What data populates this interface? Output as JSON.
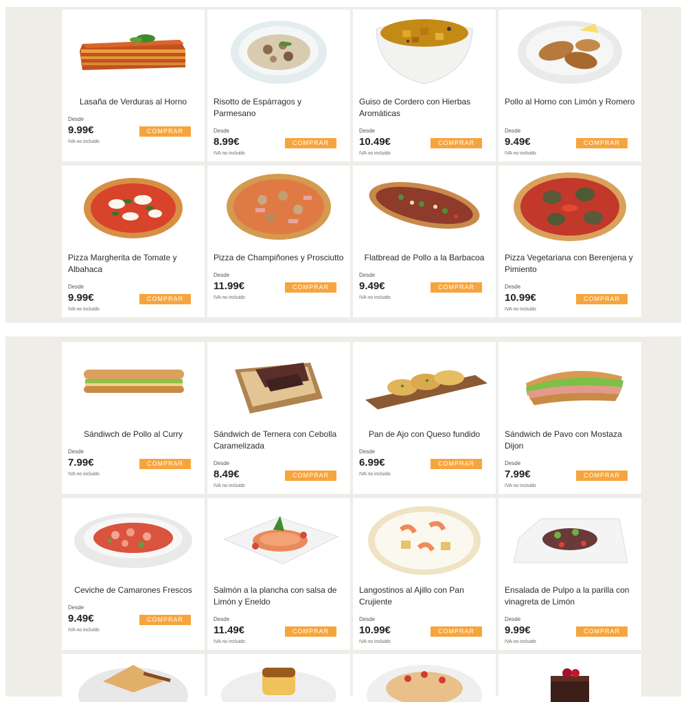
{
  "labels": {
    "desde": "Desde",
    "iva": "IVA no incluido",
    "buy": "COMPRAR"
  },
  "section1": [
    {
      "name": "Lasaña de Verduras al Horno",
      "price": "9.99€"
    },
    {
      "name": "Risotto de Espárragos y Parmesano",
      "price": "8.99€"
    },
    {
      "name": "Guiso de Cordero con Hierbas Aromáticas",
      "price": "10.49€"
    },
    {
      "name": "Pollo al Horno con Limón y Romero",
      "price": "9.49€"
    },
    {
      "name": "Pizza Margherita de Tomate y Albahaca",
      "price": "9.99€"
    },
    {
      "name": "Pizza de Champiñones y Prosciutto",
      "price": "11.99€"
    },
    {
      "name": "Flatbread de Pollo a la Barbacoa",
      "price": "9.49€"
    },
    {
      "name": "Pizza Vegetariana con Berenjena y Pimiento",
      "price": "10.99€"
    }
  ],
  "section2": [
    {
      "name": "Sándiwch de Pollo al Curry",
      "price": "7.99€"
    },
    {
      "name": "Sándwich de Ternera con Cebolla Caramelizada",
      "price": "8.49€"
    },
    {
      "name": "Pan de Ajo con Queso fundido",
      "price": "6.99€"
    },
    {
      "name": "Sándwich de Pavo con Mostaza Dijon",
      "price": "7.99€"
    },
    {
      "name": "Ceviche de Camarones Frescos",
      "price": "9.49€"
    },
    {
      "name": "Salmón a la plancha con salsa de Limón y Eneldo",
      "price": "11.49€"
    },
    {
      "name": "Langostinos al Ajillo con Pan Crujiente",
      "price": "10.99€"
    },
    {
      "name": "Ensalada de Pulpo a la parilla con vinagreta de Limón",
      "price": "9.99€"
    }
  ],
  "icons": {
    "s1": [
      "lasagna-image",
      "risotto-image",
      "lamb-stew-image",
      "roast-chicken-image",
      "pizza-margherita-image",
      "mushroom-pizza-image",
      "bbq-flatbread-image",
      "veggie-pizza-image"
    ],
    "s2": [
      "curry-chicken-sandwich-image",
      "beef-sandwich-image",
      "garlic-bread-image",
      "turkey-sandwich-image",
      "shrimp-ceviche-image",
      "salmon-plate-image",
      "garlic-prawns-image",
      "octopus-salad-image"
    ],
    "s3": [
      "crepes-image",
      "flan-image",
      "fruit-crepes-image",
      "chocolate-cake-image"
    ]
  },
  "colors": {
    "accent": "#f6a53d",
    "section_bg": "#eeede8"
  }
}
